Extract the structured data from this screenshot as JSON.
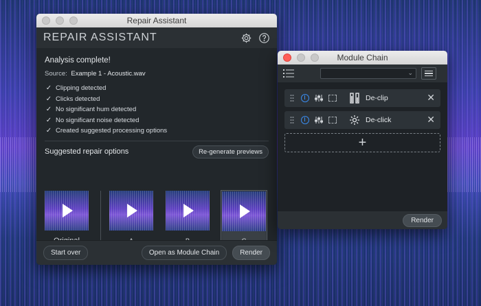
{
  "repair_assistant": {
    "window_title": "Repair Assistant",
    "header_title": "REPAIR ASSISTANT",
    "analysis_title": "Analysis complete!",
    "source_label": "Source:",
    "source_file": "Example 1 - Acoustic.wav",
    "results": [
      "Clipping detected",
      "Clicks detected",
      "No significant hum detected",
      "No significant noise detected",
      "Created suggested processing options"
    ],
    "suggested_title": "Suggested repair options",
    "regenerate_label": "Re-generate previews",
    "options": [
      {
        "label": "Original"
      },
      {
        "label": "A"
      },
      {
        "label": "B"
      },
      {
        "label": "C",
        "selected": true
      }
    ],
    "intensity_slider": {
      "minus": "-",
      "plus": "+"
    },
    "footer": {
      "start_over": "Start over",
      "open_chain": "Open as Module Chain",
      "render": "Render"
    }
  },
  "module_chain": {
    "window_title": "Module Chain",
    "preset_value": "",
    "modules": [
      {
        "name": "De-clip",
        "icon": "declip-icon"
      },
      {
        "name": "De-click",
        "icon": "declick-icon"
      }
    ],
    "add_symbol": "+",
    "render": "Render"
  },
  "colors": {
    "accent": "#3a8cf0",
    "close_red": "#ff5f57"
  }
}
